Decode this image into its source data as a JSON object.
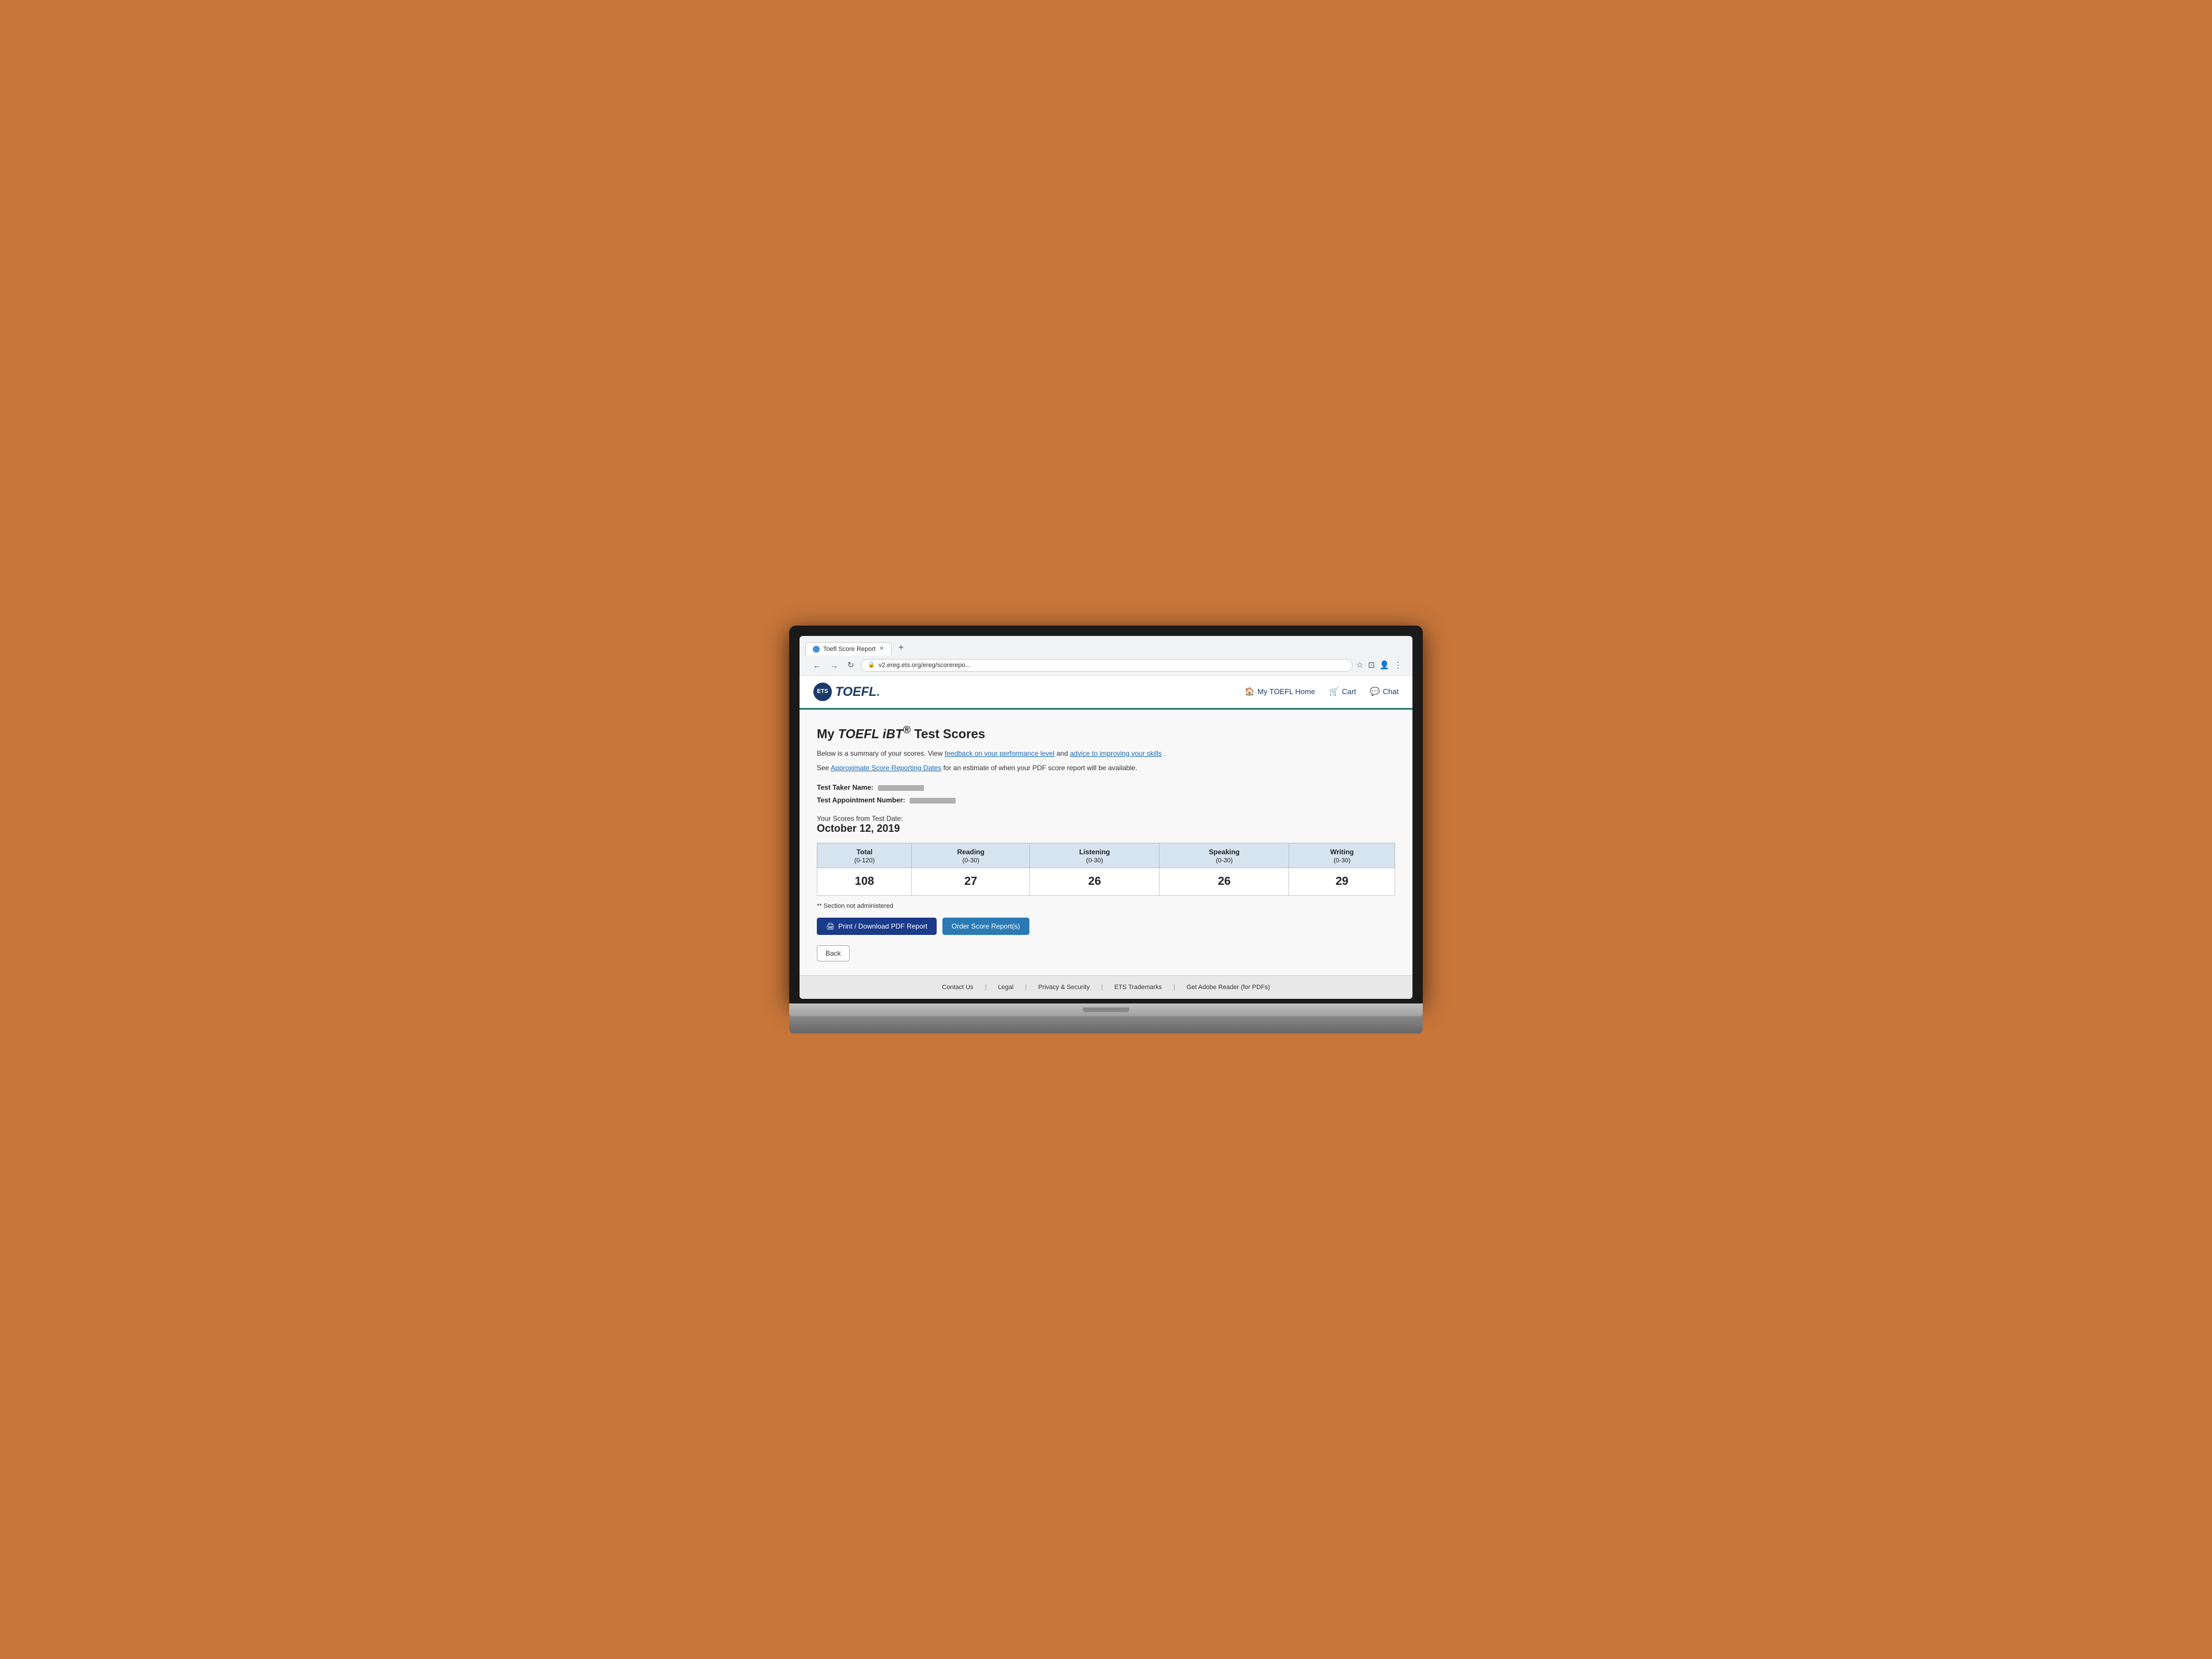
{
  "browser": {
    "tab_title": "Toefl Score Report",
    "url": "v2.ereg.ets.org/ereg/scorerepo...",
    "new_tab_label": "+",
    "nav": {
      "back": "←",
      "forward": "→",
      "refresh": "↻",
      "home": "⌂"
    }
  },
  "header": {
    "ets_badge": "ETS",
    "toefl_label": "TOEFL",
    "nav_items": [
      {
        "icon": "🏠",
        "label": "My TOEFL Home"
      },
      {
        "icon": "🛒",
        "label": "Cart"
      },
      {
        "icon": "💬",
        "label": "Chat"
      }
    ]
  },
  "main": {
    "page_title": "My TOEFL iBT® Test Scores",
    "description_1": "Below is a summary of your scores. View",
    "link_1": "feedback on your performance level",
    "description_2": "and",
    "link_2": "advice to improving your skills",
    "description_3": ".",
    "description_4": "See",
    "link_3": "Approximate Score Reporting Dates",
    "description_5": "for an estimate of when your PDF score report will be available.",
    "test_taker_label": "Test Taker Name:",
    "test_taker_value": "████████████",
    "appointment_label": "Test Appointment Number:",
    "appointment_value": "██████████████",
    "date_label": "Your Scores from Test Date:",
    "test_date": "October 12, 2019",
    "table": {
      "headers": [
        {
          "label": "Total",
          "range": "(0-120)"
        },
        {
          "label": "Reading",
          "range": "(0-30)"
        },
        {
          "label": "Listening",
          "range": "(0-30)"
        },
        {
          "label": "Speaking",
          "range": "(0-30)"
        },
        {
          "label": "Writing",
          "range": "(0-30)"
        }
      ],
      "scores": [
        {
          "total": "108",
          "reading": "27",
          "listening": "26",
          "speaking": "26",
          "writing": "29"
        }
      ]
    },
    "section_note": "** Section not administered",
    "btn_print": "Print / Download PDF Report",
    "btn_order": "Order Score Report(s)",
    "btn_back": "Back"
  },
  "footer": {
    "links": [
      "Contact Us",
      "Legal",
      "Privacy & Security",
      "ETS Trademarks",
      "Get Adobe Reader (for PDFs)"
    ]
  }
}
